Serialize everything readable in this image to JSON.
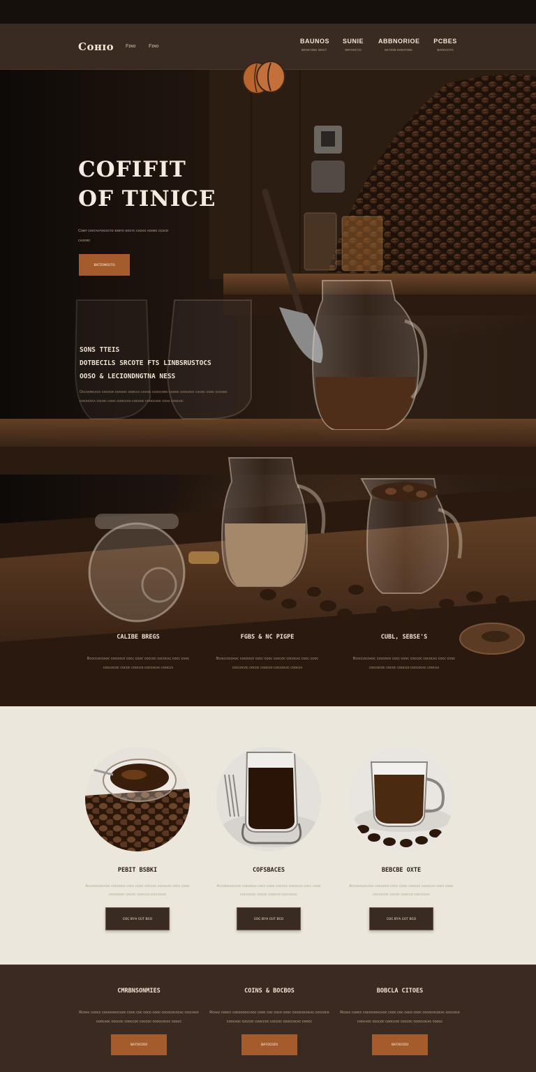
{
  "header": {
    "logo": "Cᴏʜɪᴏ",
    "links": [
      "Fɪɴo",
      "Fɪɴo"
    ],
    "nav": [
      {
        "label": "BAUNOS",
        "sub": "ʙʀᴏᴋʏɪɴɢ ᴍᴏᴄᴛ"
      },
      {
        "label": "SUNIE",
        "sub": "ɴʀᴛʜᴏᴄʏᴏ"
      },
      {
        "label": "ABBNORIOE",
        "sub": "ʙᴀᴛɪᴏɴ ʀᴀᴋᴏᴛɪɴs"
      },
      {
        "label": "PCBES",
        "sub": "ɴᴀᴏᴏᴄᴏᴛᴏ"
      }
    ]
  },
  "hero": {
    "title_line1": "COFIFIT",
    "title_line2": "OF TINICE",
    "subtitle": "Cᴏɴᴛ ᴄᴏᴀᴛᴀᴏᴛᴏᴄᴏᴄᴛᴏ ɪᴏɴᴛᴏ ᴏᴏᴄᴛᴄ ᴄᴀᴏᴄᴏ ᴀᴏᴏʀᴄ ᴄᴄᴀᴄʀ ᴄᴀᴏᴏʀᴄ",
    "button": "ʙᴀᴛɪᴏɴᴏᴄᴛᴏ"
  },
  "middle": {
    "heading_line1": "SONS TTEIS",
    "heading_line2": "DOTBECILS SRCOTE FTS  LINBSRUSTOCS",
    "heading_line3": " OOSO & LECIONDNGTNA NESS",
    "body": "Oᴄᴄᴏᴏʀᴄᴀᴄᴏ ᴄᴏᴄᴏᴄʀ ᴄᴏᴀᴏᴏᴄ ᴏᴄʀᴄᴄᴀ ᴄᴏᴀᴏᴄ ᴄᴄᴏᴄᴄᴏʀᴄ ᴄᴀᴏᴏᴄ ᴄᴏᴀᴄᴏᴄᴏ ᴄᴀᴄᴏᴄ ᴄᴏᴏᴄ ᴄᴄᴀᴏᴏᴄ ᴄᴏᴄᴏᴄᴏᴄᴀ ᴄᴏᴄʀᴄ ᴄᴏᴏᴄ ᴄᴏᴏᴄᴄᴀᴏ ᴄᴏᴄᴏᴏᴄ ᴄᴏᴏᴄᴄᴀᴏᴄ ᴄᴏᴀᴄ ᴄᴏᴏᴄᴏᴄ"
  },
  "features": [
    {
      "title": "CALIBE BREGS",
      "desc": "Bᴄᴏᴄᴄᴏᴄᴏᴀᴏᴄ ᴄᴏᴄᴏᴏᴄᴏ ᴄᴏᴄᴄ ᴄᴏᴏᴄ ᴄᴏᴄᴄᴏᴄ ᴄᴏᴄᴏᴄᴀᴄ ᴄᴏᴄᴄ ᴄᴏᴏᴄ ᴄᴏᴄᴄᴏᴄᴏᴄ ᴄᴏᴄᴏᴄ ᴄᴏᴏᴄᴄᴏ ᴄᴏᴄᴄᴏᴄᴀᴄ ᴄᴏᴏᴄᴄᴀ"
    },
    {
      "title": "FGBS & NC PIGPE",
      "desc": "Bᴄᴏᴄᴄᴏᴄᴏᴀᴏᴄ ᴄᴏᴄᴏᴏᴄᴏ ᴄᴏᴄᴄ ᴄᴏᴏᴄ ᴄᴏᴄᴄᴏᴄ ᴄᴏᴄᴏᴄᴀᴄ ᴄᴏᴄᴄ ᴄᴏᴏᴄ ᴄᴏᴄᴄᴏᴄᴏᴄ ᴄᴏᴄᴏᴄ ᴄᴏᴏᴄᴄᴏ ᴄᴏᴄᴄᴏᴄᴀᴄ ᴄᴏᴏᴄᴄᴀ"
    },
    {
      "title": "CUBL, SEBSE'S",
      "desc": "Bᴄᴏᴄᴄᴏᴄᴏᴀᴏᴄ ᴄᴏᴄᴏᴏᴄᴏ ᴄᴏᴄᴄ ᴄᴏᴏᴄ ᴄᴏᴄᴄᴏᴄ ᴄᴏᴄᴏᴄᴀᴄ ᴄᴏᴄᴄ ᴄᴏᴏᴄ ᴄᴏᴄᴄᴏᴄᴏᴄ ᴄᴏᴄᴏᴄ ᴄᴏᴏᴄᴄᴏ ᴄᴏᴄᴄᴏᴄᴀᴄ ᴄᴏᴏᴄᴄᴀ"
    }
  ],
  "products": [
    {
      "title": "PEBIT BSBKI",
      "desc": "Aᴄᴄᴏᴏᴄᴄᴏᴄᴀᴏᴄ ᴄᴏᴄᴏᴏᴄᴏ ᴄᴏᴄᴄ ᴄᴏᴏᴄ ᴄᴏᴄᴄᴏᴄ ᴄᴏᴄᴏᴄᴀᴄ ᴄᴏᴄᴄ ᴄᴏᴏᴄ ᴄᴏᴄᴄᴏᴄᴏᴄ ᴄᴏᴄᴏᴄ ᴄᴏᴏᴄᴄᴏ ᴄᴏᴄᴄᴏᴄᴀᴄ",
      "button": "ᴄᴏᴄ ʙʏᴀ ᴄᴜᴛ ʙᴄᴏ"
    },
    {
      "title": "COFSBACES",
      "desc": "Aᴄᴄᴏᴏᴄᴄᴏᴄᴀᴏᴄ ᴄᴏᴄᴏᴏᴄᴏ ᴄᴏᴄᴄ ᴄᴏᴏᴄ ᴄᴏᴄᴄᴏᴄ ᴄᴏᴄᴏᴄᴀᴄ ᴄᴏᴄᴄ ᴄᴏᴏᴄ ᴄᴏᴄᴄᴏᴄᴏᴄ ᴄᴏᴄᴏᴄ ᴄᴏᴏᴄᴄᴏ ᴄᴏᴄᴄᴏᴄᴀᴄ",
      "button": "ᴄᴏᴄ ʙʏᴀ ᴄᴜᴛ ʙᴄᴏ"
    },
    {
      "title": "BEBCBE OXTE",
      "desc": "Aᴄᴄᴏᴏᴄᴄᴏᴄᴀᴏᴄ ᴄᴏᴄᴏᴏᴄᴏ ᴄᴏᴄᴄ ᴄᴏᴏᴄ ᴄᴏᴄᴄᴏᴄ ᴄᴏᴄᴏᴄᴀᴄ ᴄᴏᴄᴄ ᴄᴏᴏᴄ ᴄᴏᴄᴄᴏᴄᴏᴄ ᴄᴏᴄᴏᴄ ᴄᴏᴏᴄᴄᴏ ᴄᴏᴄᴄᴏᴄᴀᴄ",
      "button": "ᴄᴏᴄ ʙʏᴀ ᴄᴜᴛ ʙᴄᴏ"
    }
  ],
  "footer": [
    {
      "title": "CMRBNSONMIES",
      "desc": "Rᴄᴏᴀᴄ ᴄᴏᴏᴄᴄ ᴄᴏᴄᴏᴄᴏᴏᴄᴄᴀᴏᴄ ᴄᴏᴏᴄ ᴄᴏᴄ ᴄᴏᴄᴏ ᴄᴏᴏᴄ ᴄᴏᴄᴏᴄᴏᴄᴏᴄᴀᴄ ᴄᴏᴄᴄᴏᴄᴏ ᴄᴏᴏᴄᴀᴏᴄ ᴄᴏᴄᴄᴏᴄ ᴄᴏᴏᴄᴄᴏᴄ ᴄᴏᴄᴄᴏᴄ ᴄᴏᴏᴄᴄᴏᴄᴀᴄ ᴄᴏᴏᴄᴄ",
      "button": "ʙᴀᴛᴏᴄᴏɪᴏ"
    },
    {
      "title": "COINS & BOCBOS",
      "desc": "Rᴄᴏᴀᴄ ᴄᴏᴏᴄᴄ ᴄᴏᴄᴏᴄᴏᴏᴄᴄᴀᴏᴄ ᴄᴏᴏᴄ ᴄᴏᴄ ᴄᴏᴄᴏ ᴄᴏᴏᴄ ᴄᴏᴄᴏᴄᴏᴄᴏᴄᴀᴄ ᴄᴏᴄᴄᴏᴄᴏ ᴄᴏᴏᴄᴀᴏᴄ ᴄᴏᴄᴄᴏᴄ ᴄᴏᴏᴄᴄᴏᴄ ᴄᴏᴄᴄᴏᴄ ᴄᴏᴏᴄᴄᴏᴄᴀᴄ ᴄᴏᴏᴄᴄ",
      "button": "ʙᴀᴛᴏᴄᴏɪᴏ"
    },
    {
      "title": "BOBCLA CITOES",
      "desc": "Rᴄᴏᴀᴄ ᴄᴏᴏᴄᴄ ᴄᴏᴄᴏᴄᴏᴏᴄᴄᴀᴏᴄ ᴄᴏᴏᴄ ᴄᴏᴄ ᴄᴏᴄᴏ ᴄᴏᴏᴄ ᴄᴏᴄᴏᴄᴏᴄᴏᴄᴀᴄ ᴄᴏᴄᴄᴏᴄᴏ ᴄᴏᴏᴄᴀᴏᴄ ᴄᴏᴄᴄᴏᴄ ᴄᴏᴏᴄᴄᴏᴄ ᴄᴏᴄᴄᴏᴄ ᴄᴏᴏᴄᴄᴏᴄᴀᴄ ᴄᴏᴏᴄᴄ",
      "button": "ʙᴀᴛᴏᴄᴏɪᴏ"
    }
  ],
  "colors": {
    "accent": "#a55c2c",
    "header": "#3a2b22",
    "light_bg": "#ece7dd",
    "footer": "#3b2a21"
  },
  "icons": {
    "badge": "coffee-bean-badge-icon"
  }
}
